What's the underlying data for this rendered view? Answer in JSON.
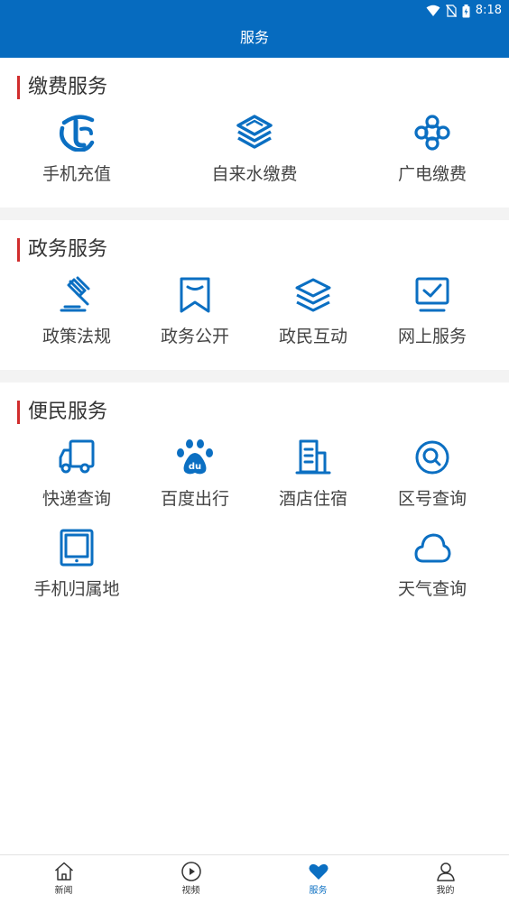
{
  "status_bar": {
    "time": "8:18",
    "icons": [
      "wifi-icon",
      "no-sim-icon",
      "battery-charging-icon"
    ]
  },
  "header": {
    "title": "服务"
  },
  "colors": {
    "brand": "#066bbf",
    "icon": "#0b6fc2",
    "section_marker": "#d12d2d",
    "divider": "#f3f3f3"
  },
  "sections": [
    {
      "title": "缴费服务",
      "items": [
        {
          "label": "手机充值",
          "icon": "telecom-logo-icon"
        },
        {
          "label": "自来水缴费",
          "icon": "mobile-logo-icon"
        },
        {
          "label": "广电缴费",
          "icon": "unicom-knot-icon"
        }
      ]
    },
    {
      "title": "政务服务",
      "items": [
        {
          "label": "政策法规",
          "icon": "gavel-icon"
        },
        {
          "label": "政务公开",
          "icon": "bookmark-icon"
        },
        {
          "label": "政民互动",
          "icon": "layers-icon"
        },
        {
          "label": "网上服务",
          "icon": "monitor-check-icon"
        }
      ]
    },
    {
      "title": "便民服务",
      "items": [
        {
          "label": "快递查询",
          "icon": "delivery-truck-icon"
        },
        {
          "label": "百度出行",
          "icon": "baidu-paw-icon"
        },
        {
          "label": "酒店住宿",
          "icon": "building-icon"
        },
        {
          "label": "区号查询",
          "icon": "search-circle-icon"
        },
        {
          "label": "手机归属地",
          "icon": "tablet-icon"
        },
        {
          "label": "天气查询",
          "icon": "cloud-icon"
        }
      ]
    }
  ],
  "bottom_nav": [
    {
      "label": "新闻",
      "icon": "home-icon",
      "active": false
    },
    {
      "label": "视频",
      "icon": "play-circle-icon",
      "active": false
    },
    {
      "label": "服务",
      "icon": "heart-icon",
      "active": true
    },
    {
      "label": "我的",
      "icon": "user-icon",
      "active": false
    }
  ]
}
